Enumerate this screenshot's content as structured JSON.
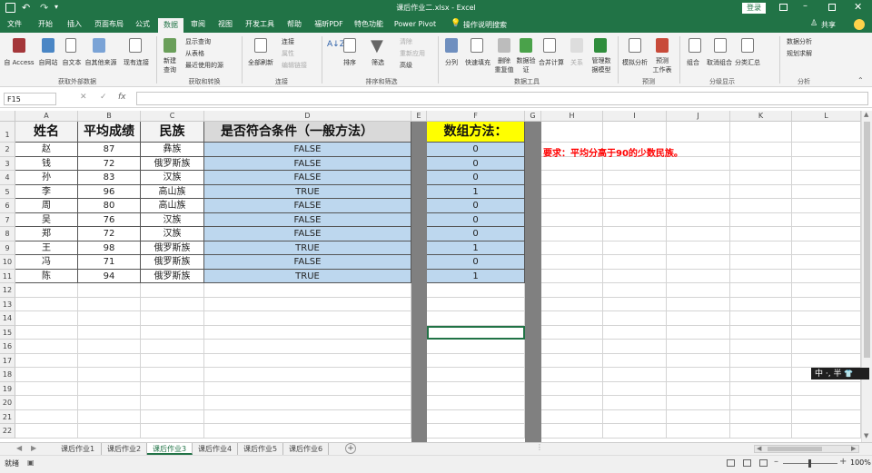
{
  "title": {
    "doc": "课后作业二.xlsx - Excel",
    "login": "登录"
  },
  "tabs": [
    "文件",
    "开始",
    "插入",
    "页面布局",
    "公式",
    "数据",
    "审阅",
    "视图",
    "开发工具",
    "帮助",
    "福昕PDF",
    "特色功能",
    "Power Pivot"
  ],
  "tell_me": "操作说明搜索",
  "share": "共享",
  "ribbon": {
    "get_ext": {
      "label": "获取外部数据",
      "items": [
        "自 Access",
        "自网站",
        "自文本",
        "自其他来源",
        "现有连接"
      ]
    },
    "get_trans": {
      "label": "获取和转换",
      "new_query": "新建\n查询",
      "items": [
        "显示查询",
        "从表格",
        "最近使用的源"
      ]
    },
    "conn": {
      "label": "连接",
      "refresh": "全部刷新",
      "items": [
        "连接",
        "属性",
        "编辑链接"
      ]
    },
    "sort": {
      "label": "排序和筛选",
      "sort": "排序",
      "filter": "筛选",
      "items": [
        "清除",
        "重新应用",
        "高级"
      ]
    },
    "tools": {
      "label": "数据工具",
      "items": [
        "分列",
        "快速填充",
        "删除\n重复值",
        "数据验\n证",
        "合并计算",
        "关系",
        "管理数\n据模型"
      ]
    },
    "forecast": {
      "label": "预测",
      "items": [
        "模拟分析",
        "预测\n工作表"
      ]
    },
    "outline": {
      "label": "分级显示",
      "items": [
        "组合",
        "取消组合",
        "分类汇总"
      ]
    },
    "analysis": {
      "label": "分析",
      "items": [
        "数据分析",
        "规划求解"
      ]
    }
  },
  "formula_bar": {
    "name_box": "F15",
    "fx": "fx",
    "value": ""
  },
  "columns": [
    "A",
    "B",
    "C",
    "D",
    "E",
    "F",
    "G",
    "H",
    "I",
    "J",
    "K",
    "L"
  ],
  "rows": [
    "1",
    "2",
    "3",
    "4",
    "5",
    "6",
    "7",
    "8",
    "9",
    "10",
    "11",
    "12",
    "13",
    "14",
    "15",
    "16",
    "17",
    "18",
    "19",
    "20",
    "21",
    "22"
  ],
  "headers": {
    "a": "姓名",
    "b": "平均成绩",
    "c": "民族",
    "d": "是否符合条件（一般方法）",
    "f": "数组方法："
  },
  "table": [
    {
      "name": "赵",
      "score": "87",
      "nation": "彝族",
      "flag": "FALSE",
      "arr": "0"
    },
    {
      "name": "钱",
      "score": "72",
      "nation": "俄罗斯族",
      "flag": "FALSE",
      "arr": "0"
    },
    {
      "name": "孙",
      "score": "83",
      "nation": "汉族",
      "flag": "FALSE",
      "arr": "0"
    },
    {
      "name": "李",
      "score": "96",
      "nation": "高山族",
      "flag": "TRUE",
      "arr": "1"
    },
    {
      "name": "周",
      "score": "80",
      "nation": "高山族",
      "flag": "FALSE",
      "arr": "0"
    },
    {
      "name": "吴",
      "score": "76",
      "nation": "汉族",
      "flag": "FALSE",
      "arr": "0"
    },
    {
      "name": "郑",
      "score": "72",
      "nation": "汉族",
      "flag": "FALSE",
      "arr": "0"
    },
    {
      "name": "王",
      "score": "98",
      "nation": "俄罗斯族",
      "flag": "TRUE",
      "arr": "1"
    },
    {
      "name": "冯",
      "score": "71",
      "nation": "俄罗斯族",
      "flag": "FALSE",
      "arr": "0"
    },
    {
      "name": "陈",
      "score": "94",
      "nation": "俄罗斯族",
      "flag": "TRUE",
      "arr": "1"
    }
  ],
  "requirement": "要求：平均分高于90的少数民族。",
  "sheets": [
    "课后作业1",
    "课后作业2",
    "课后作业3",
    "课后作业4",
    "课后作业5",
    "课后作业6"
  ],
  "active_sheet": "课后作业3",
  "status": {
    "ready": "就绪",
    "zoom": "100%"
  },
  "ime": "中 ·, 半",
  "colors": {
    "excel_green": "#217346",
    "blue_fill": "#bdd7ee",
    "yellow": "#ffff00",
    "gray": "#808080",
    "red_text": "#ff0000"
  }
}
